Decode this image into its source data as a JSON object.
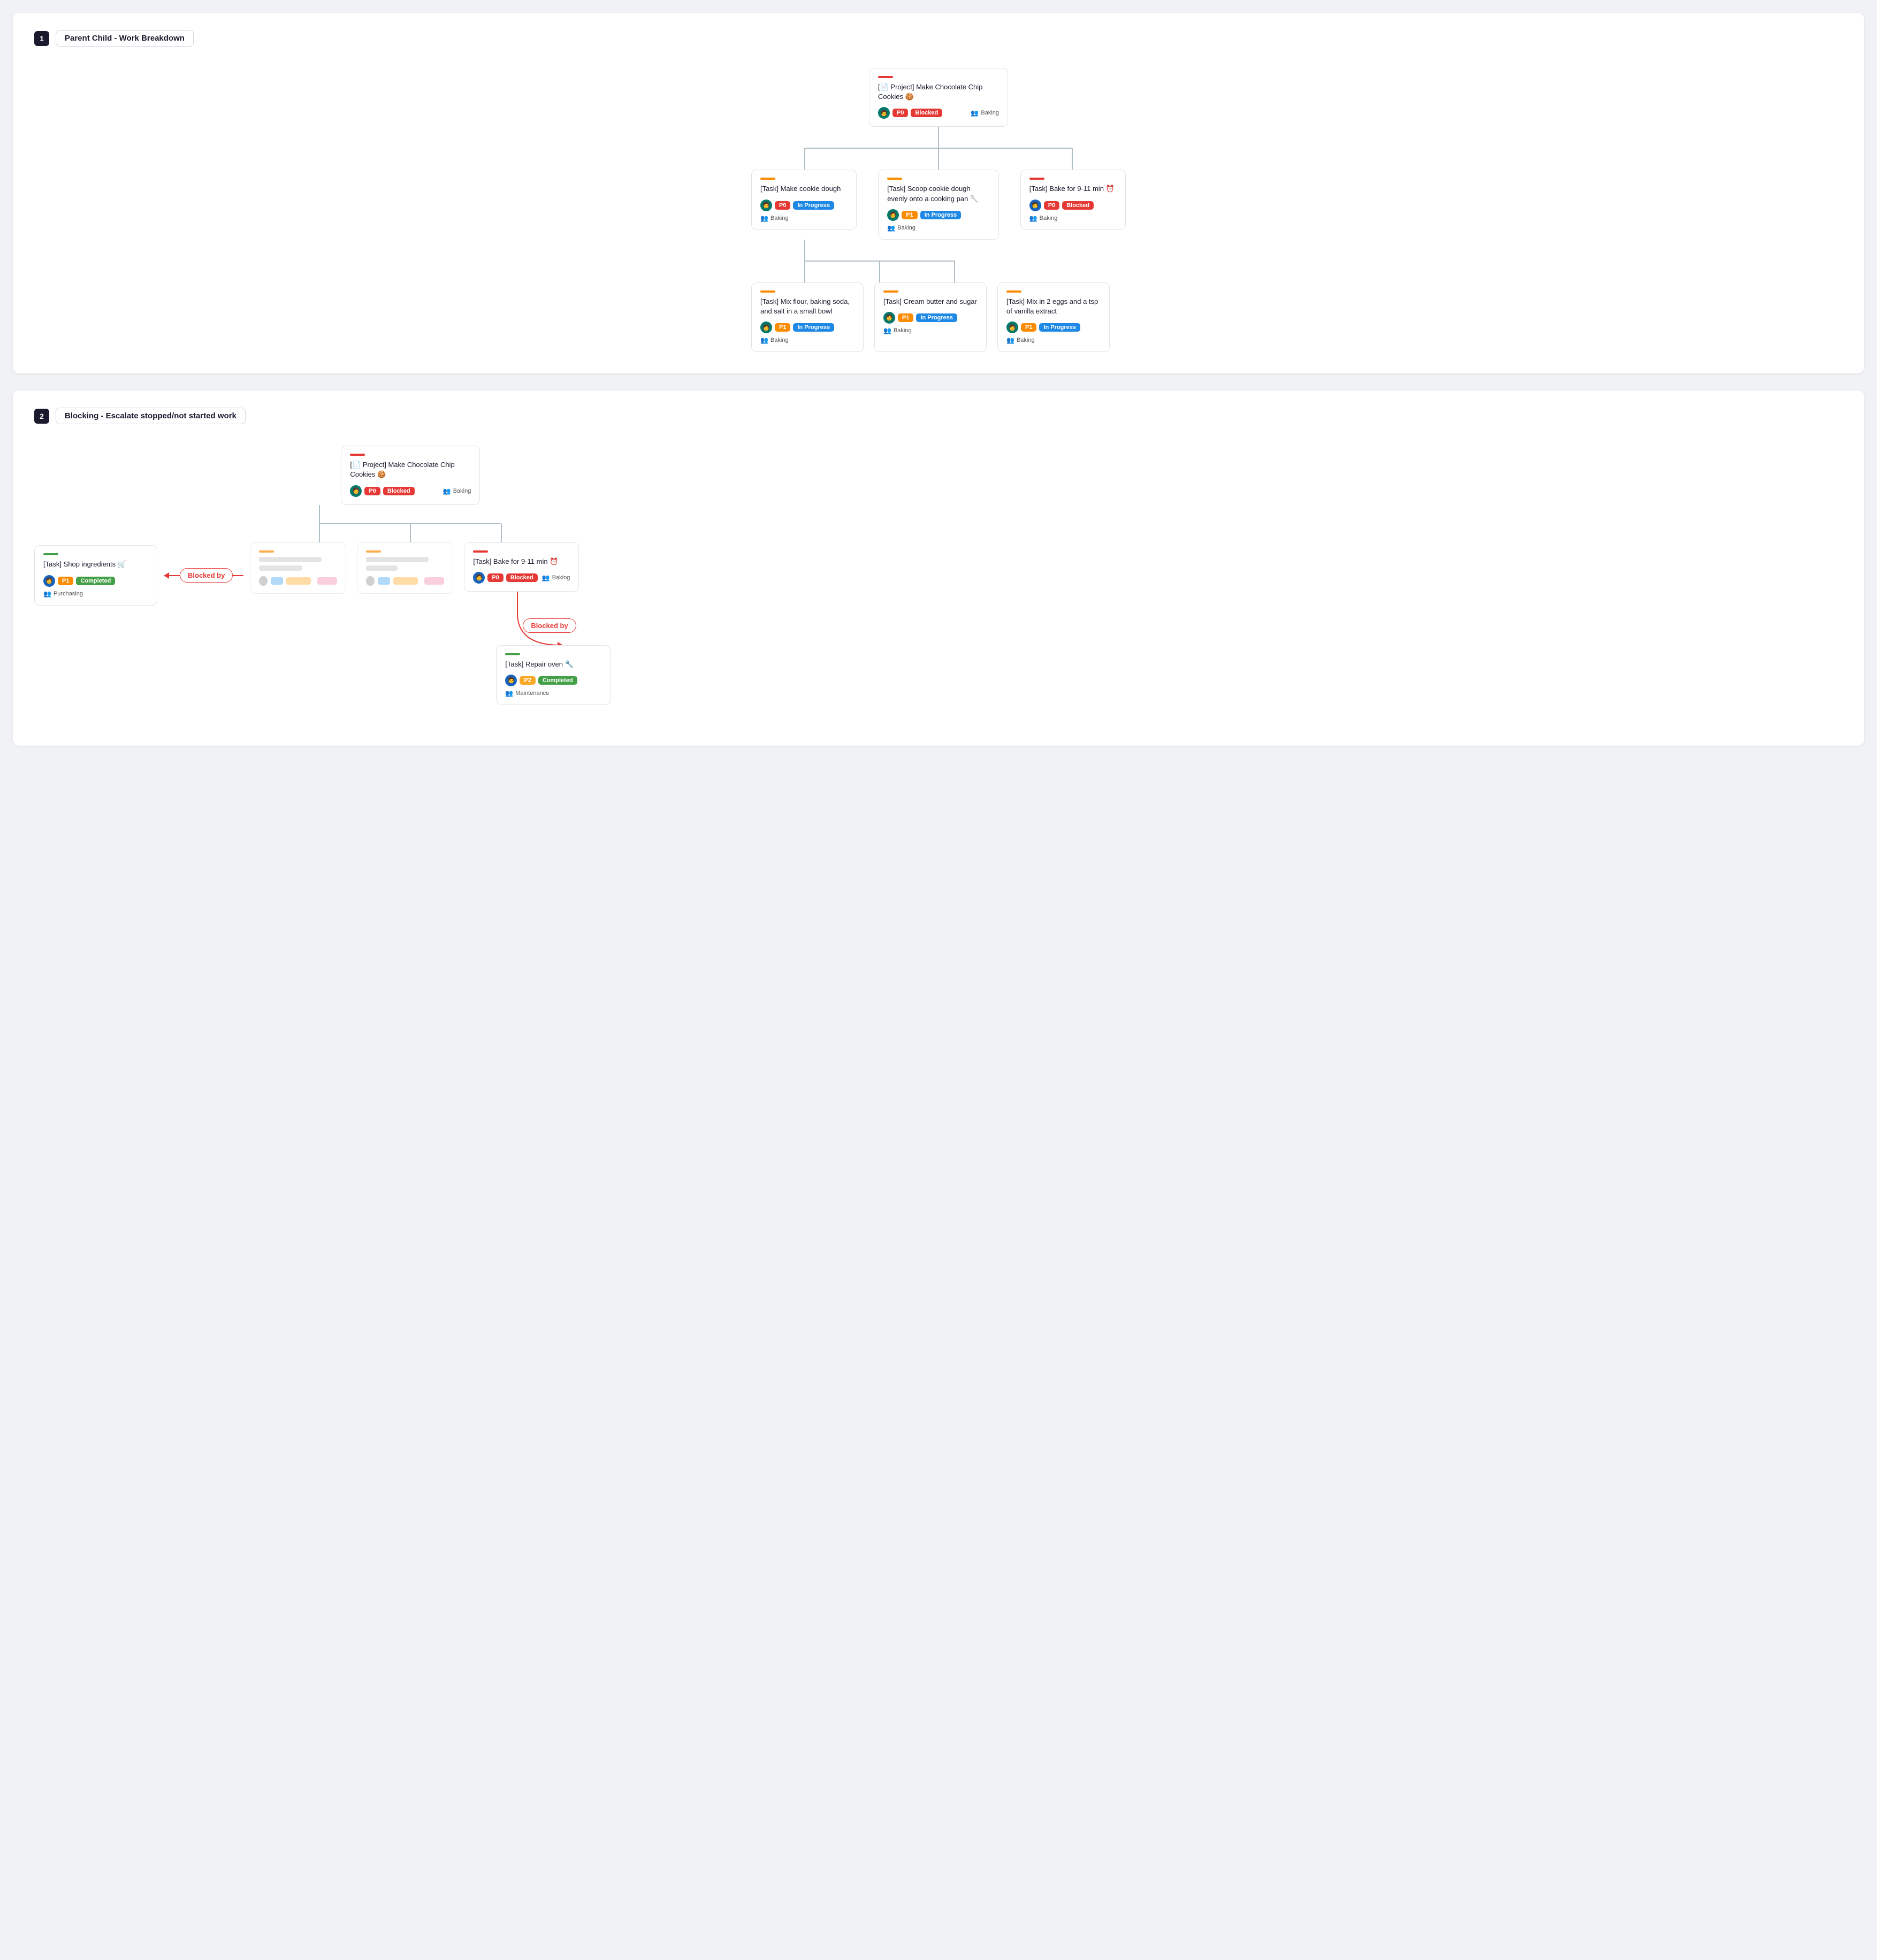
{
  "section1": {
    "number": "1",
    "title": "Parent Child - Work Breakdown",
    "root": {
      "accent": "red",
      "title": "[📄 Project] Make Chocolate Chip Cookies 🍪",
      "priority": "P0",
      "status": "Blocked",
      "team": "Baking"
    },
    "level2": [
      {
        "accent": "orange",
        "title": "[Task] Make cookie dough",
        "priority": "P0",
        "status": "In Progress",
        "team": "Baking"
      },
      {
        "accent": "orange",
        "title": "[Task] Scoop cookie dough evenly onto a cooking pan 🥄",
        "priority": "P1",
        "status": "In Progress",
        "team": "Baking"
      },
      {
        "accent": "red",
        "title": "[Task] Bake for 9-11 min ⏰",
        "priority": "P0",
        "status": "Blocked",
        "team": "Baking"
      }
    ],
    "level3": [
      {
        "accent": "orange",
        "title": "[Task] Mix flour, baking soda, and salt in a small bowl",
        "priority": "P1",
        "status": "In Progress",
        "team": "Baking"
      },
      {
        "accent": "orange",
        "title": "[Task] Cream butter and sugar",
        "priority": "P1",
        "status": "In Progress",
        "team": "Baking"
      },
      {
        "accent": "orange",
        "title": "[Task] Mix in 2 eggs and a tsp of vanilla extract",
        "priority": "P1",
        "status": "In Progress",
        "team": "Baking"
      }
    ]
  },
  "section2": {
    "number": "2",
    "title": "Blocking - Escalate stopped/not started work",
    "shop_task": {
      "accent": "green",
      "title": "[Task] Shop ingredients 🛒",
      "priority": "P1",
      "status": "Completed",
      "team": "Purchasing"
    },
    "blocked_by_label": "Blocked by",
    "root": {
      "accent": "red",
      "title": "[📄 Project] Make Chocolate Chip Cookies 🍪",
      "priority": "P0",
      "status": "Blocked",
      "team": "Baking"
    },
    "level2_blurred": [
      {
        "type": "blurred"
      },
      {
        "type": "blurred"
      }
    ],
    "bake_task": {
      "accent": "red",
      "title": "[Task] Bake for 9-11 min ⏰",
      "priority": "P0",
      "status": "Blocked",
      "team": "Baking"
    },
    "repair_task": {
      "accent": "green",
      "title": "[Task] Repair oven 🔧",
      "priority": "P2",
      "status": "Completed",
      "team": "Maintenance"
    },
    "blocked_by_right": "Blocked by"
  },
  "badges": {
    "P0": "P0",
    "P1": "P1",
    "P2": "P2",
    "Blocked": "Blocked",
    "In Progress": "In Progress",
    "Completed": "Completed"
  }
}
